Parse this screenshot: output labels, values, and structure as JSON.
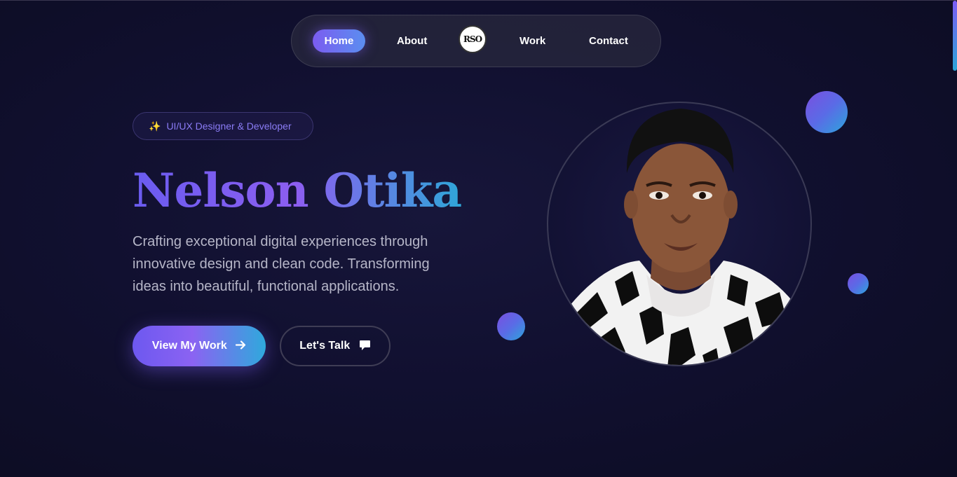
{
  "nav": {
    "home": "Home",
    "about": "About",
    "logo_text": "RSO",
    "work": "Work",
    "contact": "Contact"
  },
  "badge": {
    "icon": "sparkles-icon",
    "text": "UI/UX Designer & Developer"
  },
  "hero": {
    "name": "Nelson Otika",
    "description": "Crafting exceptional digital experiences through innovative design and clean code. Transforming ideas into beautiful, functional applications."
  },
  "buttons": {
    "primary_label": "View My Work",
    "primary_icon": "arrow-right-icon",
    "secondary_label": "Let's Talk",
    "secondary_icon": "chat-bubble-icon"
  },
  "colors": {
    "background": "#0f0f2a",
    "accent_purple": "#7b5cf0",
    "accent_blue": "#2fa6d8",
    "badge_text": "#8b7cf6",
    "body_text": "#b6b6c8"
  }
}
